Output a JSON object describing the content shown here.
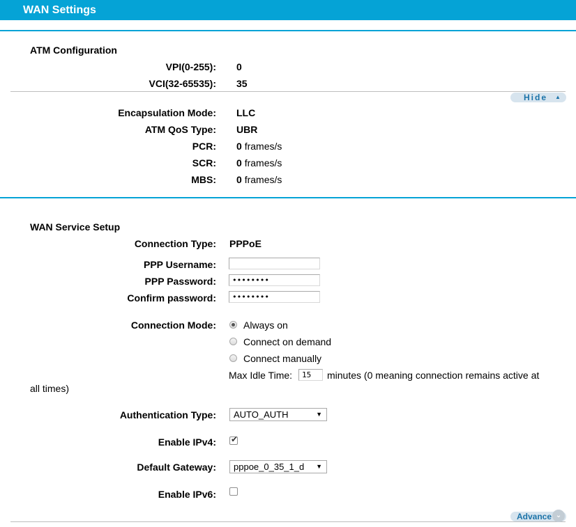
{
  "header": {
    "title": "WAN Settings"
  },
  "atm": {
    "section_title": "ATM Configuration",
    "vpi_label": "VPI(0-255):",
    "vpi_value": "0",
    "vci_label": "VCI(32-65535):",
    "vci_value": "35",
    "hide_label": "Hide",
    "encapsulation_label": "Encapsulation Mode:",
    "encapsulation_value": "LLC",
    "qos_label": "ATM QoS Type:",
    "qos_value": "UBR",
    "pcr_label": "PCR:",
    "pcr_value": "0",
    "scr_label": "SCR:",
    "scr_value": "0",
    "mbs_label": "MBS:",
    "mbs_value": "0",
    "unit": "frames/s"
  },
  "wan_service": {
    "section_title": "WAN Service Setup",
    "connection_type_label": "Connection Type:",
    "connection_type_value": "PPPoE",
    "ppp_username_label": "PPP Username:",
    "ppp_username_value": "",
    "ppp_password_label": "PPP Password:",
    "ppp_password_value": "••••••••",
    "confirm_password_label": "Confirm password:",
    "confirm_password_value": "••••••••",
    "connection_mode_label": "Connection Mode:",
    "modes": [
      "Always on",
      "Connect on demand",
      "Connect manually"
    ],
    "selected_mode": "Always on",
    "max_idle_label": "Max Idle Time:",
    "max_idle_value": "15",
    "max_idle_suffix": "minutes (0 meaning connection remains active at",
    "max_idle_suffix2": "all times)",
    "auth_type_label": "Authentication Type:",
    "auth_type_value": "AUTO_AUTH",
    "enable_ipv4_label": "Enable IPv4:",
    "enable_ipv4_checked": true,
    "default_gateway_label": "Default Gateway:",
    "default_gateway_value": "pppoe_0_35_1_d",
    "enable_ipv6_label": "Enable IPv6:",
    "enable_ipv6_checked": false,
    "advance_label": "Advance"
  },
  "colors": {
    "accent": "#05a3d6",
    "pill_bg": "#d7e4ee",
    "pill_text": "#1b73a8"
  },
  "icons": {
    "hide": "triangle-up-icon",
    "advance": "chevron-down-circle-icon"
  }
}
